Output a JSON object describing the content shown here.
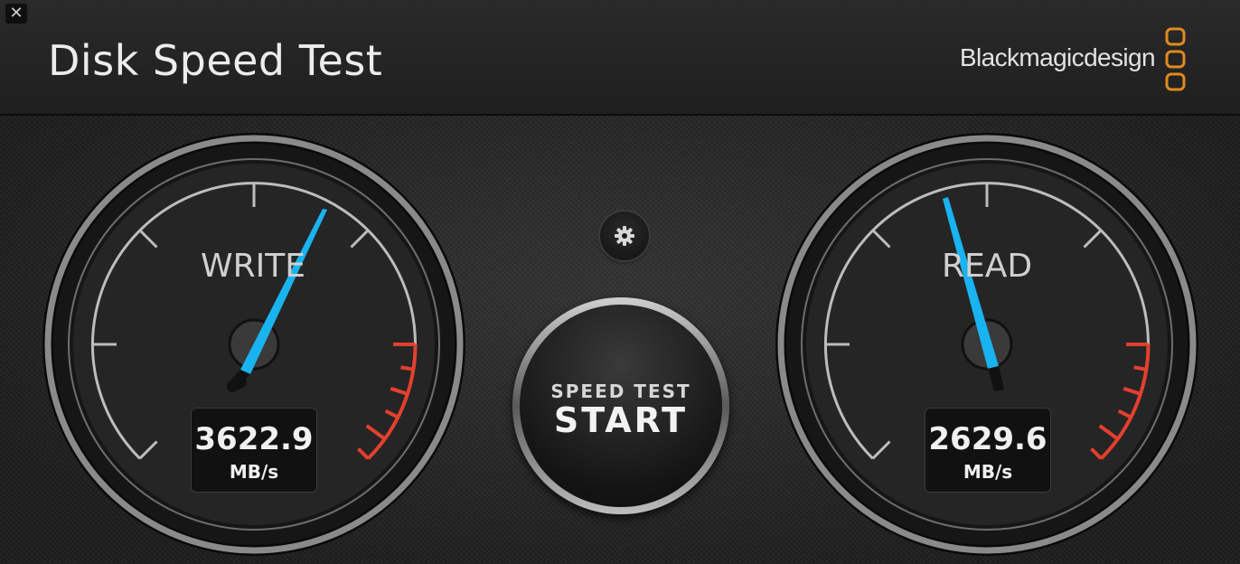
{
  "app": {
    "title": "Disk Speed Test",
    "close_label": "✕",
    "brand": "Blackmagicdesign",
    "brand_color": "#e08a1e"
  },
  "controls": {
    "settings_icon": "gear-icon",
    "start_button": {
      "line1": "SPEED TEST",
      "line2": "START"
    }
  },
  "gauges": {
    "write": {
      "label": "WRITE",
      "value": "3622.9",
      "unit": "MB/s",
      "needle_color": "#19b3f0"
    },
    "read": {
      "label": "READ",
      "value": "2629.6",
      "unit": "MB/s",
      "needle_color": "#19b3f0"
    }
  },
  "colors": {
    "redline": "#e4402f",
    "needle": "#19b3f0"
  }
}
